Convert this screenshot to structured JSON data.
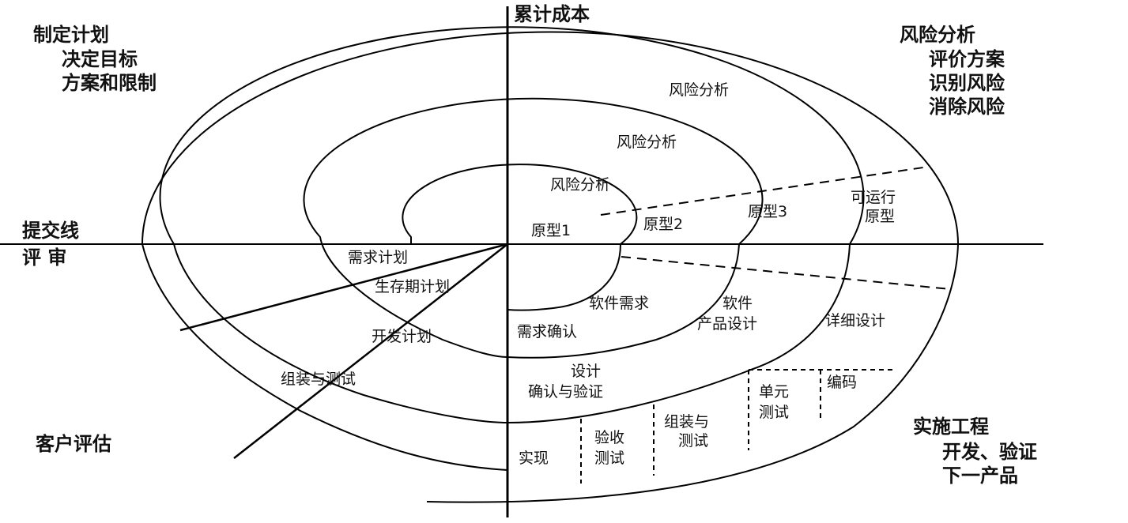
{
  "axes": {
    "cumulative_cost": "累计成本",
    "submit_line": "提交线",
    "review": "评 审"
  },
  "quadrants": {
    "planning": {
      "title": "制定计划",
      "items": [
        "决定目标",
        "方案和限制"
      ]
    },
    "risk": {
      "title": "风险分析",
      "items": [
        "评价方案",
        "识别风险",
        "消除风险"
      ]
    },
    "customer": {
      "title": "客户评估"
    },
    "engineering": {
      "title": "实施工程",
      "items": [
        "开发、验证",
        "下一产品"
      ]
    }
  },
  "risk_labels": [
    "风险分析",
    "风险分析",
    "风险分析"
  ],
  "prototypes": [
    "原型1",
    "原型2",
    "原型3",
    "可运行",
    "原型"
  ],
  "plans": [
    "需求计划",
    "生存期计划",
    "开发计划",
    "组装与测试"
  ],
  "engineering_steps": {
    "software_requirements": "软件需求",
    "requirements_confirm": "需求确认",
    "software": "软件",
    "product_design": "产品设计",
    "detailed_design": "详细设计",
    "design": "设计",
    "confirm_verify": "确认与验证",
    "implement": "实现",
    "acceptance": "验收",
    "acceptance_test": "测试",
    "assembly": "组装与",
    "assembly_test": "测试",
    "unit": "单元",
    "unit_test": "测试",
    "coding": "编码"
  }
}
